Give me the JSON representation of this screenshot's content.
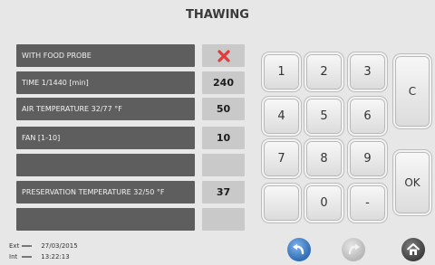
{
  "header": {
    "title": "THAWING"
  },
  "params": [
    {
      "label": "WITH FOOD PROBE",
      "value": "",
      "icon": "red-x-icon"
    },
    {
      "label": "TIME 1/1440 [min]",
      "value": "240"
    },
    {
      "label": "AIR TEMPERATURE  32/77 °F",
      "value": "50"
    },
    {
      "label": "FAN [1-10]",
      "value": "10"
    },
    {
      "label": "",
      "value": ""
    },
    {
      "label": "PRESERVATION TEMPERATURE 32/50 °F",
      "value": "37"
    },
    {
      "label": "",
      "value": ""
    }
  ],
  "keypad": {
    "digits": [
      "1",
      "2",
      "3",
      "4",
      "5",
      "6",
      "7",
      "8",
      "9",
      "",
      "0",
      "-"
    ],
    "clear_label": "C",
    "ok_label": "OK"
  },
  "footer": {
    "ext_label": "Ext",
    "int_label": "Int",
    "date": "27/03/2015",
    "time": "13:22:13"
  },
  "nav": {
    "back_icon": "back-arrow-icon",
    "forward_icon": "forward-arrow-icon",
    "home_icon": "home-icon"
  },
  "colors": {
    "accent_blue": "#2f6db4",
    "error_red": "#e23b3b"
  }
}
